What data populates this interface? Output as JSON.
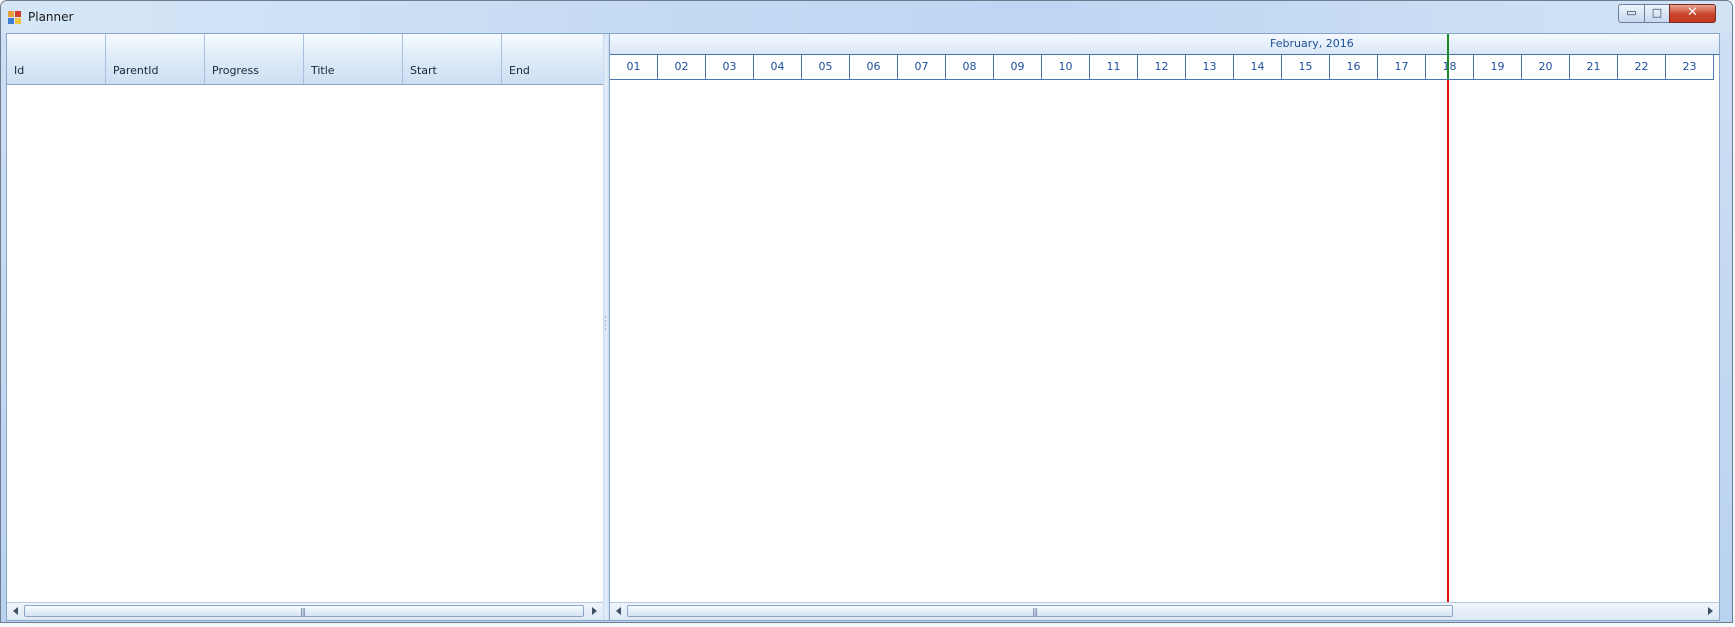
{
  "window": {
    "title": "Planner",
    "controls": {
      "minimize": "▭",
      "maximize": "□",
      "close": "✕"
    }
  },
  "grid": {
    "columns": [
      "Id",
      "ParentId",
      "Progress",
      "Title",
      "Start",
      "End"
    ],
    "rows": []
  },
  "gantt": {
    "month_label": "February, 2016",
    "days": [
      "01",
      "02",
      "03",
      "04",
      "05",
      "06",
      "07",
      "08",
      "09",
      "10",
      "11",
      "12",
      "13",
      "14",
      "15",
      "16",
      "17",
      "18",
      "19",
      "20",
      "21",
      "22",
      "23"
    ],
    "today": "18",
    "colors": {
      "today_marker": "#1a8a2a",
      "today_line": "#e0120e"
    }
  },
  "scrollbars": {
    "grip": "|||"
  }
}
